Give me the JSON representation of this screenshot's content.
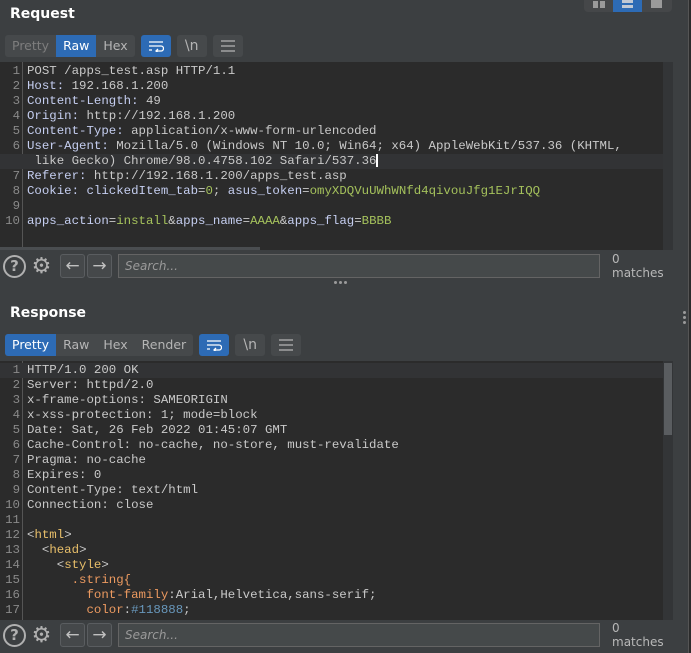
{
  "layout_switch": {
    "options": [
      {
        "icon": "columns-layout-icon",
        "active": false
      },
      {
        "icon": "rows-layout-icon",
        "active": true
      },
      {
        "icon": "single-layout-icon",
        "active": false
      }
    ]
  },
  "request": {
    "title": "Request",
    "tabs": [
      {
        "label": "Pretty",
        "active": false,
        "dim": true
      },
      {
        "label": "Raw",
        "active": true
      },
      {
        "label": "Hex",
        "active": false
      }
    ],
    "tools": {
      "wrap_icon": "wrap-lines-icon",
      "newline_label": "\\n",
      "menu_icon": "hamburger-menu-icon"
    },
    "lines": [
      {
        "n": "1",
        "parts": [
          {
            "t": "POST /apps_test.asp HTTP/1.1",
            "c": "v"
          }
        ]
      },
      {
        "n": "2",
        "parts": [
          {
            "t": "Host:",
            "c": "k"
          },
          {
            "t": " 192.168.1.200",
            "c": "v"
          }
        ]
      },
      {
        "n": "3",
        "parts": [
          {
            "t": "Content-Length:",
            "c": "k"
          },
          {
            "t": " 49",
            "c": "v"
          }
        ]
      },
      {
        "n": "4",
        "parts": [
          {
            "t": "Origin:",
            "c": "k"
          },
          {
            "t": " http://192.168.1.200",
            "c": "v"
          }
        ]
      },
      {
        "n": "5",
        "parts": [
          {
            "t": "Content-Type:",
            "c": "k"
          },
          {
            "t": " application/x-www-form-urlencoded",
            "c": "v"
          }
        ]
      },
      {
        "n": "6",
        "parts": [
          {
            "t": "User-Agent:",
            "c": "k"
          },
          {
            "t": " Mozilla/5.0 (Windows NT 10.0; Win64; x64) AppleWebKit/537.36 (KHTML,",
            "c": "v"
          }
        ]
      },
      {
        "n": "",
        "cur": true,
        "caret": true,
        "parts": [
          {
            "t": " like Gecko) Chrome/98.0.4758.102 Safari/537.36",
            "c": "v"
          }
        ]
      },
      {
        "n": "7",
        "parts": [
          {
            "t": "Referer:",
            "c": "k"
          },
          {
            "t": " http://192.168.1.200/apps_test.asp",
            "c": "v"
          }
        ]
      },
      {
        "n": "8",
        "parts": [
          {
            "t": "Cookie:",
            "c": "k"
          },
          {
            "t": " clickedItem_tab",
            "c": "k"
          },
          {
            "t": "=",
            "c": "p"
          },
          {
            "t": "0",
            "c": "g"
          },
          {
            "t": "; ",
            "c": "p"
          },
          {
            "t": "asus_token",
            "c": "k"
          },
          {
            "t": "=",
            "c": "p"
          },
          {
            "t": "omyXDQVuUWhWNfd4qivouJfg1EJrIQQ",
            "c": "g"
          }
        ]
      },
      {
        "n": "9",
        "parts": []
      },
      {
        "n": "10",
        "parts": [
          {
            "t": "apps_action",
            "c": "k"
          },
          {
            "t": "=",
            "c": "p"
          },
          {
            "t": "install",
            "c": "g"
          },
          {
            "t": "&",
            "c": "p"
          },
          {
            "t": "apps_name",
            "c": "k"
          },
          {
            "t": "=",
            "c": "p"
          },
          {
            "t": "AAAA",
            "c": "g"
          },
          {
            "t": "&",
            "c": "p"
          },
          {
            "t": "apps_flag",
            "c": "k"
          },
          {
            "t": "=",
            "c": "p"
          },
          {
            "t": "BBBB",
            "c": "g"
          }
        ]
      }
    ],
    "search": {
      "placeholder": "Search...",
      "value": "",
      "matches": "0 matches"
    }
  },
  "response": {
    "title": "Response",
    "tabs": [
      {
        "label": "Pretty",
        "active": true
      },
      {
        "label": "Raw",
        "active": false
      },
      {
        "label": "Hex",
        "active": false
      },
      {
        "label": "Render",
        "active": false
      }
    ],
    "tools": {
      "wrap_icon": "wrap-lines-icon",
      "newline_label": "\\n",
      "menu_icon": "hamburger-menu-icon"
    },
    "lines": [
      {
        "n": "1",
        "cur": true,
        "parts": [
          {
            "t": "HTTP/1.0 200 OK",
            "c": "v"
          }
        ]
      },
      {
        "n": "2",
        "parts": [
          {
            "t": "Server:",
            "c": "v"
          },
          {
            "t": " httpd/2.0",
            "c": "v"
          }
        ]
      },
      {
        "n": "3",
        "parts": [
          {
            "t": "x-frame-options:",
            "c": "v"
          },
          {
            "t": " SAMEORIGIN",
            "c": "v"
          }
        ]
      },
      {
        "n": "4",
        "parts": [
          {
            "t": "x-xss-protection:",
            "c": "v"
          },
          {
            "t": " 1; mode=block",
            "c": "v"
          }
        ]
      },
      {
        "n": "5",
        "parts": [
          {
            "t": "Date:",
            "c": "v"
          },
          {
            "t": " Sat, 26 Feb 2022 01:45:07 GMT",
            "c": "v"
          }
        ]
      },
      {
        "n": "6",
        "parts": [
          {
            "t": "Cache-Control:",
            "c": "v"
          },
          {
            "t": " no-cache, no-store, must-revalidate",
            "c": "v"
          }
        ]
      },
      {
        "n": "7",
        "parts": [
          {
            "t": "Pragma:",
            "c": "v"
          },
          {
            "t": " no-cache",
            "c": "v"
          }
        ]
      },
      {
        "n": "8",
        "parts": [
          {
            "t": "Expires:",
            "c": "v"
          },
          {
            "t": " 0",
            "c": "v"
          }
        ]
      },
      {
        "n": "9",
        "parts": [
          {
            "t": "Content-Type:",
            "c": "v"
          },
          {
            "t": " text/html",
            "c": "v"
          }
        ]
      },
      {
        "n": "10",
        "parts": [
          {
            "t": "Connection:",
            "c": "v"
          },
          {
            "t": " close",
            "c": "v"
          }
        ]
      },
      {
        "n": "11",
        "parts": []
      },
      {
        "n": "12",
        "parts": [
          {
            "t": "<",
            "c": "br"
          },
          {
            "t": "html",
            "c": "tag"
          },
          {
            "t": ">",
            "c": "br"
          }
        ]
      },
      {
        "n": "13",
        "parts": [
          {
            "t": "  <",
            "c": "br"
          },
          {
            "t": "head",
            "c": "tag"
          },
          {
            "t": ">",
            "c": "br"
          }
        ]
      },
      {
        "n": "14",
        "parts": [
          {
            "t": "    <",
            "c": "br"
          },
          {
            "t": "style",
            "c": "tag"
          },
          {
            "t": ">",
            "c": "br"
          }
        ]
      },
      {
        "n": "15",
        "parts": [
          {
            "t": "      .string{",
            "c": "css-sel"
          }
        ]
      },
      {
        "n": "16",
        "parts": [
          {
            "t": "        font-family",
            "c": "css-prop"
          },
          {
            "t": ":Arial,Helvetica,sans-serif;",
            "c": "v"
          }
        ]
      },
      {
        "n": "17",
        "parts": [
          {
            "t": "        color",
            "c": "css-prop"
          },
          {
            "t": ":",
            "c": "v"
          },
          {
            "t": "#118888",
            "c": "css-num"
          },
          {
            "t": ";",
            "c": "v"
          }
        ]
      }
    ],
    "search": {
      "placeholder": "Search...",
      "value": "",
      "matches": "0 matches"
    }
  }
}
